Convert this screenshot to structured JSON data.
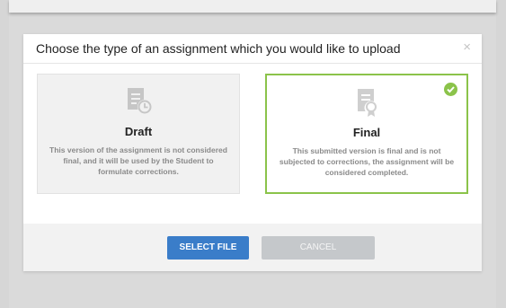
{
  "modal": {
    "title": "Choose the type of an assignment which you would like to upload",
    "close_symbol": "×"
  },
  "options": [
    {
      "title": "Draft",
      "description": "This version of the assignment is not considered final, and it will be used by the Student to formulate corrections.",
      "icon": "document-clock-icon",
      "selected": false
    },
    {
      "title": "Final",
      "description": "This submitted version is final and is not subjected to corrections, the assignment will be considered completed.",
      "icon": "document-certificate-icon",
      "selected": true
    }
  ],
  "footer": {
    "select_label": "SELECT FILE",
    "cancel_label": "CANCEL"
  },
  "colors": {
    "selected_border": "#8bc34a",
    "primary_button": "#3a7dc9",
    "disabled_button": "#c5c8cb"
  }
}
